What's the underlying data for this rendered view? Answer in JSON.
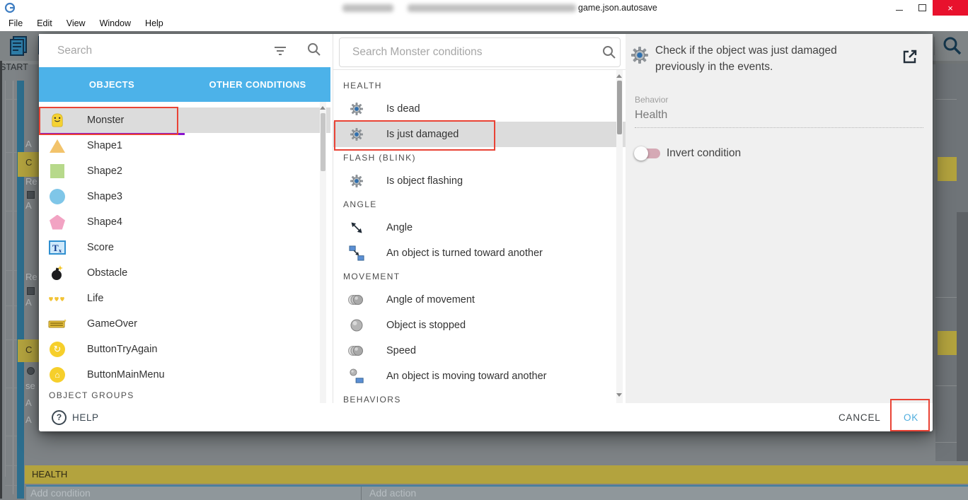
{
  "window": {
    "title": "game.json.autosave",
    "controls": [
      "minimize",
      "restore",
      "close"
    ]
  },
  "menu": {
    "items": [
      "File",
      "Edit",
      "View",
      "Window",
      "Help"
    ]
  },
  "toolbar": {
    "left_icons": [
      "project-manager",
      "scene-editor"
    ],
    "right_icons": [
      "play",
      "debug",
      "add-event",
      "add-sub-event",
      "add-comment",
      "add-new",
      "delete-event",
      "undo",
      "redo",
      "search"
    ]
  },
  "background": {
    "scene_tab": "START",
    "fragments": [
      "A",
      "C",
      "Re",
      "A",
      "Re",
      "A",
      "C",
      "se",
      "A",
      "A"
    ],
    "bottom": {
      "comment": "HEALTH",
      "add_condition": "Add condition",
      "add_action": "Add action"
    }
  },
  "dialog": {
    "left": {
      "search_placeholder": "Search",
      "tabs": [
        {
          "label": "OBJECTS",
          "active": true
        },
        {
          "label": "OTHER CONDITIONS",
          "active": false
        }
      ],
      "objects": [
        {
          "label": "Monster",
          "icon": "monster",
          "selected": true
        },
        {
          "label": "Shape1",
          "icon": "triangle"
        },
        {
          "label": "Shape2",
          "icon": "square"
        },
        {
          "label": "Shape3",
          "icon": "circle"
        },
        {
          "label": "Shape4",
          "icon": "pentagon"
        },
        {
          "label": "Score",
          "icon": "text-object"
        },
        {
          "label": "Obstacle",
          "icon": "bomb"
        },
        {
          "label": "Life",
          "icon": "hearts"
        },
        {
          "label": "GameOver",
          "icon": "banner"
        },
        {
          "label": "ButtonTryAgain",
          "icon": "retry-button"
        },
        {
          "label": "ButtonMainMenu",
          "icon": "home-button"
        }
      ],
      "groups_header": "OBJECT GROUPS"
    },
    "middle": {
      "search_placeholder": "Search Monster conditions",
      "sections": [
        {
          "header": "HEALTH",
          "items": [
            {
              "label": "Is dead",
              "icon": "behavior-gear"
            },
            {
              "label": "Is just damaged",
              "icon": "behavior-gear",
              "selected": true
            }
          ]
        },
        {
          "header": "FLASH (BLINK)",
          "items": [
            {
              "label": "Is object flashing",
              "icon": "behavior-gear"
            }
          ]
        },
        {
          "header": "ANGLE",
          "items": [
            {
              "label": "Angle",
              "icon": "angle-arrows"
            },
            {
              "label": "An object is turned toward another",
              "icon": "turned-toward"
            }
          ]
        },
        {
          "header": "MOVEMENT",
          "items": [
            {
              "label": "Angle of movement",
              "icon": "movement-circles"
            },
            {
              "label": "Object is stopped",
              "icon": "stopped-circle"
            },
            {
              "label": "Speed",
              "icon": "movement-circles"
            },
            {
              "label": "An object is moving toward another",
              "icon": "moving-toward"
            }
          ]
        },
        {
          "header": "BEHAVIORS",
          "items": []
        }
      ]
    },
    "right": {
      "description": "Check if the object was just damaged previously in the events.",
      "behavior_label": "Behavior",
      "behavior_value": "Health",
      "invert_label": "Invert condition"
    },
    "footer": {
      "help": "HELP",
      "cancel": "CANCEL",
      "ok": "OK"
    }
  },
  "colors": {
    "tab_bar": "#4cb2e9",
    "tab_underline": "#8a13ce",
    "highlight_red": "#e94335",
    "ok_blue": "#4fadde",
    "selected_row": "#dcdcdc",
    "comment_yellow": "#b3a33e",
    "event_bar_blue": "#2d6e8e"
  }
}
